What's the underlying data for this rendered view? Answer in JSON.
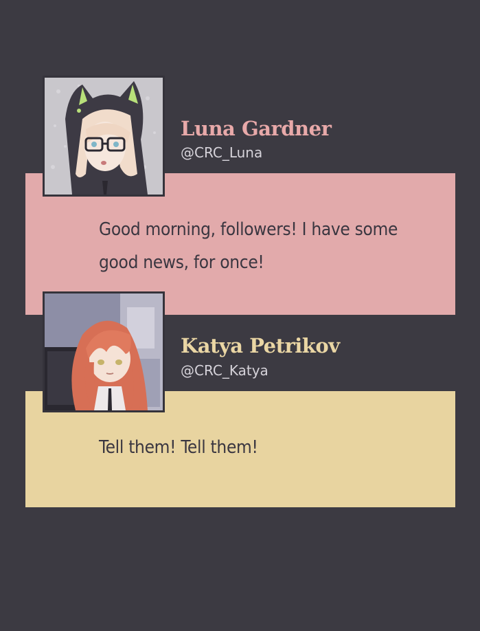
{
  "posts": [
    {
      "author_name": "Luna Gardner",
      "handle": "@CRC_Luna",
      "message": "Good morning, followers! I have some good news, for once!",
      "accent_color": "#e8a9a9",
      "bubble_color": "#e2aaab",
      "avatar": "cat-hood-girl-avatar"
    },
    {
      "author_name": "Katya Petrikov",
      "handle": "@CRC_Katya",
      "message": "Tell them! Tell them!",
      "accent_color": "#ead6a4",
      "bubble_color": "#e8d4a0",
      "avatar": "red-haired-girl-avatar"
    }
  ],
  "background_color": "#3c3a42"
}
